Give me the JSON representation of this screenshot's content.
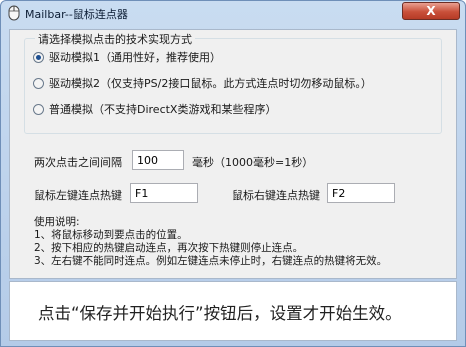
{
  "window": {
    "title": "Mailbar--鼠标连点器",
    "close_glyph": "X"
  },
  "tech_group": {
    "title": "请选择模拟点击的技术实现方式",
    "options": [
      {
        "label": "驱动模拟1（通用性好，推荐使用）",
        "checked": true
      },
      {
        "label": "驱动模拟2（仅支持PS/2接口鼠标。此方式连点时切勿移动鼠标。）",
        "checked": false
      },
      {
        "label": "普通模拟（不支持DirectX类游戏和某些程序）",
        "checked": false
      }
    ]
  },
  "interval": {
    "label": "两次点击之间间隔",
    "value": "100",
    "unit": "毫秒（1000毫秒=1秒）"
  },
  "hotkeys": {
    "left_label": "鼠标左键连点热键",
    "left_value": "F1",
    "right_label": "鼠标右键连点热键",
    "right_value": "F2"
  },
  "help": {
    "title": "使用说明:",
    "lines": [
      "1、将鼠标移动到要点击的位置。",
      "2、按下相应的热键启动连点，再次按下热键则停止连点。",
      "3、左右键不能同时连点。例如左键连点未停止时，右键连点的热键将无效。"
    ]
  },
  "footer": {
    "message": "点击“保存并开始执行”按钮后，设置才开始生效。"
  }
}
